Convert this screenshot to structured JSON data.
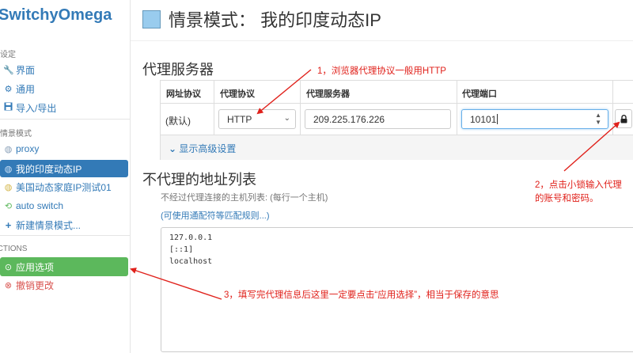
{
  "sidebar": {
    "brand": "SwitchyOmega",
    "settings_label": "设定",
    "settings_items": [
      {
        "label": "界面",
        "icon": "wrench-icon"
      },
      {
        "label": "通用",
        "icon": "gear-icon"
      },
      {
        "label": "导入/导出",
        "icon": "floppy-icon"
      }
    ],
    "profiles_label": "情景模式",
    "profiles": [
      {
        "label": "proxy",
        "icon": "globe-icon"
      },
      {
        "label": "我的印度动态IP",
        "icon": "globe-icon"
      },
      {
        "label": "美国动态家庭IP测试01",
        "icon": "globe-icon"
      },
      {
        "label": "auto switch",
        "icon": "refresh-icon"
      },
      {
        "label": "新建情景模式...",
        "icon": "plus-icon"
      }
    ],
    "actions_label": "ACTIONS",
    "actions": {
      "apply": "应用选项",
      "discard": "撤销更改"
    }
  },
  "header": {
    "title": "情景模式：  我的印度动态IP",
    "swatch_color": "#99ccee"
  },
  "proxy_servers": {
    "heading": "代理服务器",
    "columns": [
      "网址协议",
      "代理协议",
      "代理服务器",
      "代理端口"
    ],
    "row": {
      "scheme": "(默认)",
      "protocol": "HTTP",
      "server": "209.225.176.226",
      "port": "10101"
    },
    "advanced_link": "显示高级设置"
  },
  "bypass": {
    "heading": "不代理的地址列表",
    "description": "不经过代理连接的主机列表: (每行一个主机)",
    "wildcard_link": "(可使用通配符等匹配规则...)",
    "entries": [
      "127.0.0.1",
      "[::1]",
      "localhost"
    ]
  },
  "annotations": {
    "note1": "1，浏览器代理协议一般用HTTP",
    "note2_line1": "2，点击小锁输入代理",
    "note2_line2": "的账号和密码。",
    "note3": "3，填写完代理信息后这里一定要点击“应用选择”，相当于保存的意思",
    "color": "#e0211b"
  }
}
